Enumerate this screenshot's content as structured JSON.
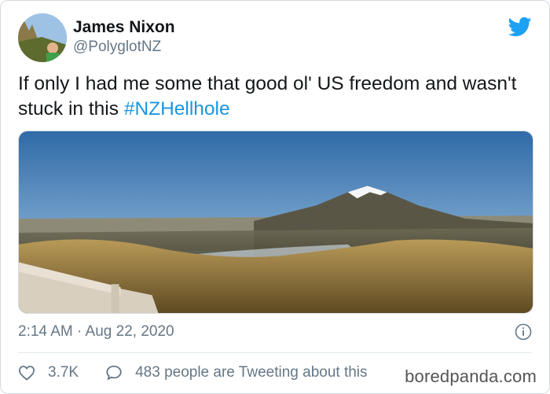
{
  "user": {
    "name": "James Nixon",
    "handle": "@PolyglotNZ"
  },
  "tweet": {
    "text_before": "If only I had me some that good ol' US freedom and wasn't stuck in this ",
    "hashtag": "#NZHellhole",
    "timestamp": "2:14 AM · Aug 22, 2020"
  },
  "photo": {
    "description_icon": "mountain-photo"
  },
  "stats": {
    "likes": "3.7K",
    "tweeting": "483 people are Tweeting about this"
  },
  "watermark": "boredpanda.com",
  "colors": {
    "twitter_blue": "#1da1f2",
    "hashtag": "#1b95e0",
    "secondary_text": "#657786"
  },
  "icons": {
    "logo": "twitter-bird-icon",
    "info": "info-icon",
    "like": "heart-icon",
    "reply": "speech-bubble-icon"
  }
}
